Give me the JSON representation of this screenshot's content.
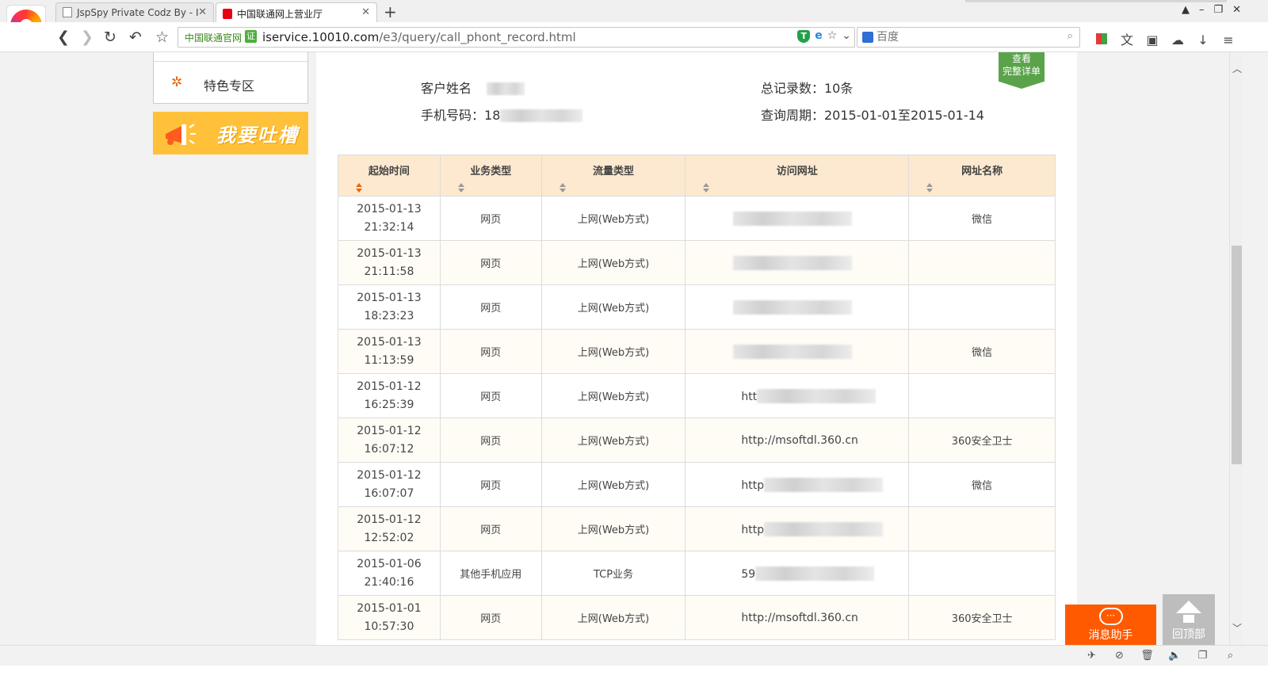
{
  "browser": {
    "tabs": [
      {
        "title": "JspSpy Private Codz By - I"
      },
      {
        "title": "中国联通网上营业厅"
      }
    ],
    "new_tab_symbol": "+",
    "address": {
      "ev_label": "中国联通官网",
      "ev_badge": "证",
      "url_host": "iservice.10010.com",
      "url_path": "/e3/query/call_phont_record.html"
    },
    "search": {
      "placeholder": "百度"
    }
  },
  "sidebar": {
    "special_label": "特色专区",
    "complain_label": "我要吐槽"
  },
  "ribbon": {
    "line1": "查看",
    "line2": "完整详单"
  },
  "customer": {
    "name_label": "客户姓名",
    "phone_label": "手机号码：",
    "phone_prefix": "18",
    "total_label": "总记录数：10条",
    "period_label": "查询周期：2015-01-01至2015-01-14"
  },
  "table": {
    "headers": [
      "起始时间",
      "业务类型",
      "流量类型",
      "访问网址",
      "网址名称"
    ],
    "rows": [
      {
        "date": "2015-01-13",
        "time": "21:32:14",
        "biz": "网页",
        "traffic": "上网(Web方式)",
        "url": "",
        "site": "微信"
      },
      {
        "date": "2015-01-13",
        "time": "21:11:58",
        "biz": "网页",
        "traffic": "上网(Web方式)",
        "url": "",
        "site": ""
      },
      {
        "date": "2015-01-13",
        "time": "18:23:23",
        "biz": "网页",
        "traffic": "上网(Web方式)",
        "url": "",
        "site": ""
      },
      {
        "date": "2015-01-13",
        "time": "11:13:59",
        "biz": "网页",
        "traffic": "上网(Web方式)",
        "url": "",
        "site": "微信"
      },
      {
        "date": "2015-01-12",
        "time": "16:25:39",
        "biz": "网页",
        "traffic": "上网(Web方式)",
        "url": "htt",
        "site": ""
      },
      {
        "date": "2015-01-12",
        "time": "16:07:12",
        "biz": "网页",
        "traffic": "上网(Web方式)",
        "url": "http://msoftdl.360.cn",
        "site": "360安全卫士"
      },
      {
        "date": "2015-01-12",
        "time": "16:07:07",
        "biz": "网页",
        "traffic": "上网(Web方式)",
        "url": "http",
        "site": "微信"
      },
      {
        "date": "2015-01-12",
        "time": "12:52:02",
        "biz": "网页",
        "traffic": "上网(Web方式)",
        "url": "http",
        "site": ""
      },
      {
        "date": "2015-01-06",
        "time": "21:40:16",
        "biz": "其他手机应用",
        "traffic": "TCP业务",
        "url": "59",
        "site": ""
      },
      {
        "date": "2015-01-01",
        "time": "10:57:30",
        "biz": "网页",
        "traffic": "上网(Web方式)",
        "url": "http://msoftdl.360.cn",
        "site": "360安全卫士"
      }
    ]
  },
  "floating": {
    "msg_helper": "消息助手",
    "back_to_top": "回顶部"
  },
  "colors": {
    "accent_orange": "#ff5a00",
    "header_bg": "#fde9cf",
    "ribbon_green": "#5aa34a",
    "complain_yellow": "#ffc13a"
  }
}
